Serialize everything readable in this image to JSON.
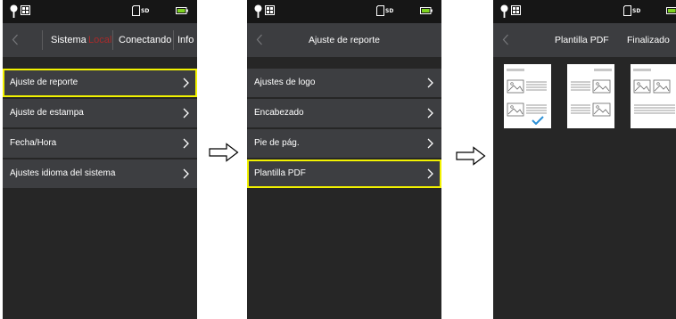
{
  "colors": {
    "screen_bg": "#262626",
    "status_bar": "#161616",
    "nav_bar": "#3c3d40",
    "row_bg": "#3d3e41",
    "highlight": "#f2f200",
    "active_tab": "#ab2a2a"
  },
  "status_bar": {
    "sd_label": "SD",
    "icons": [
      "location-icon",
      "grid-icon",
      "sd-card-icon",
      "battery-icon"
    ]
  },
  "screen1": {
    "tabs": [
      {
        "label": "Sistema"
      },
      {
        "label": "Local"
      },
      {
        "label": "Conectando"
      },
      {
        "label": "Info"
      }
    ],
    "menu": [
      {
        "label": "Ajuste de reporte",
        "highlighted": true
      },
      {
        "label": "Ajuste de estampa",
        "highlighted": false
      },
      {
        "label": "Fecha/Hora",
        "highlighted": false
      },
      {
        "label": "Ajustes idioma del sistema",
        "highlighted": false
      }
    ]
  },
  "screen2": {
    "title": "Ajuste de reporte",
    "menu": [
      {
        "label": "Ajustes de logo",
        "highlighted": false
      },
      {
        "label": "Encabezado",
        "highlighted": false
      },
      {
        "label": "Pie de pág.",
        "highlighted": false
      },
      {
        "label": "Plantilla PDF",
        "highlighted": true
      }
    ]
  },
  "screen3": {
    "title": "Plantilla PDF",
    "action": "Finalizado",
    "templates": [
      {
        "name": "template-1",
        "selected": true
      },
      {
        "name": "template-2",
        "selected": false
      },
      {
        "name": "template-3",
        "selected": false
      }
    ]
  },
  "flow_arrows": [
    "arrow-right-icon",
    "arrow-right-icon"
  ]
}
